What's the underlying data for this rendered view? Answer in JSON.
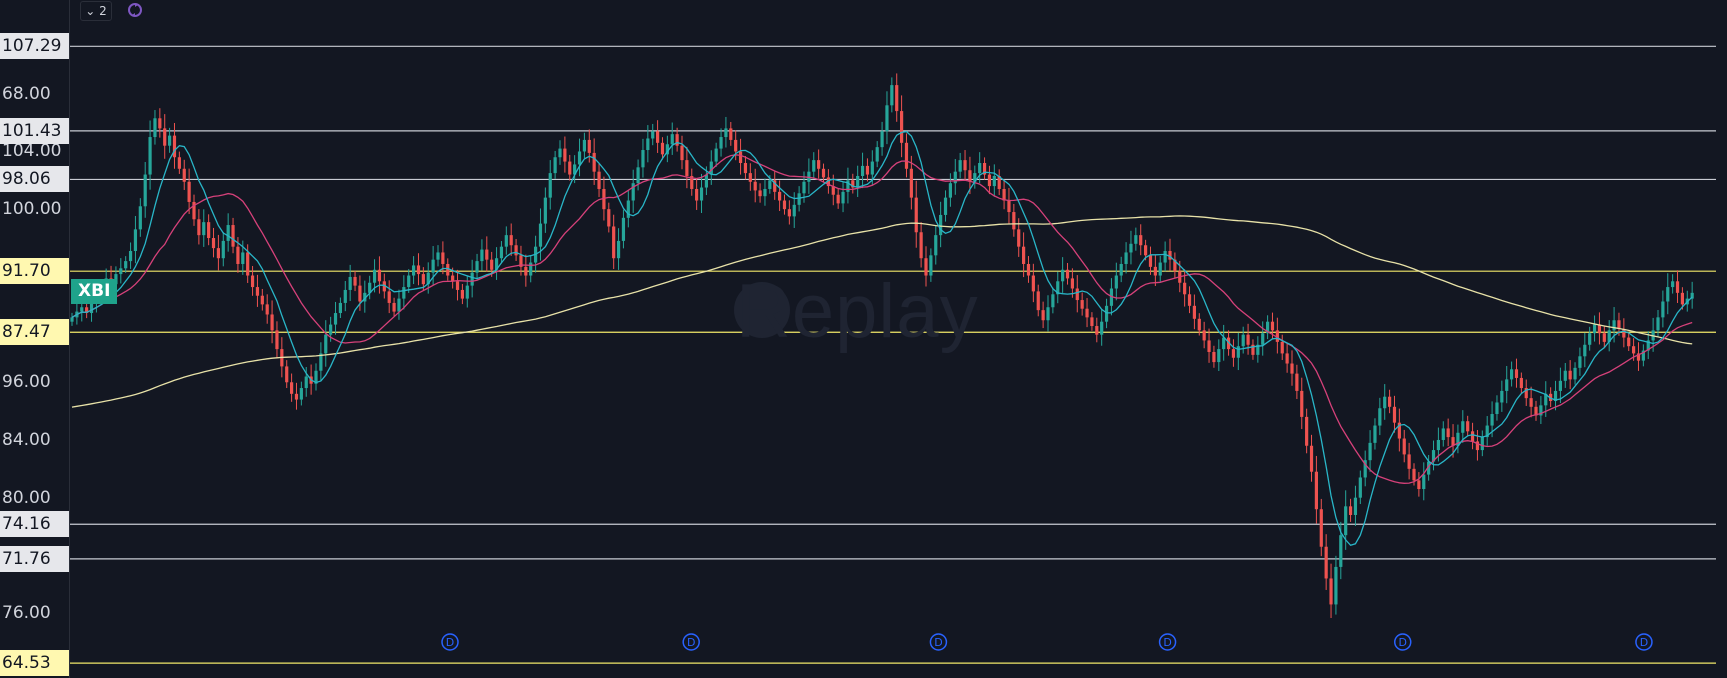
{
  "toolbar": {
    "collapse_label": "⌄ 2",
    "sync_icon": "sync-icon"
  },
  "symbol": "XBI",
  "watermark": "Replay",
  "colors": {
    "background": "#131722",
    "up": "#26a69a",
    "down": "#ef5350",
    "ma_fast": "#29b6c8",
    "ma_mid": "#d6417a",
    "ma_slow": "#e8e2a8",
    "hline_white": "#c8cbd3",
    "hline_yellow": "#f2e86a",
    "dividend_marker": "#2962ff"
  },
  "dividend_marker_label": "D",
  "chart_data": {
    "type": "candlestick",
    "symbol": "XBI",
    "ylim": [
      63.5,
      110.5
    ],
    "y_tick_labels": [
      "76.00",
      "80.00",
      "84.00",
      "96.00",
      "100.00",
      "104.00",
      "68.00"
    ],
    "y_ticks": [
      68,
      76,
      80,
      84,
      96,
      100,
      104
    ],
    "horizontal_levels": [
      {
        "label": "107.29",
        "value": 107.29,
        "color": "white"
      },
      {
        "label": "101.43",
        "value": 101.43,
        "color": "white"
      },
      {
        "label": "98.06",
        "value": 98.06,
        "color": "white"
      },
      {
        "label": "91.70",
        "value": 91.7,
        "color": "yellow"
      },
      {
        "label": "87.47",
        "value": 87.47,
        "color": "yellow"
      },
      {
        "label": "74.16",
        "value": 74.16,
        "color": "white"
      },
      {
        "label": "71.76",
        "value": 71.76,
        "color": "white"
      },
      {
        "label": "64.53",
        "value": 64.53,
        "color": "yellow"
      }
    ],
    "dividend_markers_bar_index": [
      64,
      104,
      145,
      183,
      222,
      262
    ],
    "closes": [
      88.5,
      88.9,
      89.2,
      88.8,
      89.6,
      90.1,
      90.6,
      91.2,
      90.8,
      91.5,
      91.9,
      92.4,
      93.1,
      94.6,
      96.2,
      98.4,
      101.0,
      102.3,
      101.6,
      100.4,
      101.1,
      99.6,
      98.8,
      97.9,
      96.5,
      95.3,
      94.2,
      95.1,
      94.0,
      93.3,
      92.6,
      93.8,
      94.9,
      93.4,
      92.2,
      93.0,
      91.4,
      90.6,
      90.0,
      89.4,
      88.7,
      87.6,
      86.3,
      85.1,
      84.0,
      83.2,
      82.8,
      83.6,
      84.4,
      83.9,
      84.8,
      86.0,
      87.3,
      88.0,
      88.8,
      89.5,
      90.4,
      91.3,
      90.7,
      89.6,
      90.2,
      90.9,
      91.8,
      91.0,
      90.3,
      89.5,
      88.9,
      89.8,
      90.6,
      91.4,
      92.1,
      91.5,
      90.8,
      91.6,
      92.5,
      93.0,
      92.2,
      91.4,
      91.0,
      90.4,
      89.8,
      90.7,
      91.6,
      92.4,
      93.2,
      92.5,
      91.8,
      92.6,
      93.4,
      94.2,
      93.5,
      92.8,
      92.0,
      91.4,
      92.3,
      93.4,
      95.0,
      96.8,
      98.5,
      99.6,
      100.2,
      99.3,
      98.4,
      99.1,
      100.0,
      100.8,
      99.9,
      98.6,
      97.4,
      96.0,
      94.8,
      92.6,
      93.8,
      95.4,
      96.6,
      97.8,
      98.9,
      100.1,
      100.9,
      101.4,
      100.6,
      99.8,
      100.5,
      101.2,
      100.4,
      99.4,
      98.3,
      97.4,
      96.6,
      97.5,
      98.4,
      99.3,
      100.2,
      101.0,
      101.6,
      100.8,
      100.0,
      99.2,
      98.5,
      97.9,
      97.3,
      96.9,
      97.4,
      98.0,
      97.2,
      96.6,
      96.0,
      95.5,
      96.3,
      97.1,
      97.9,
      98.6,
      99.4,
      98.8,
      98.2,
      97.6,
      97.0,
      96.4,
      97.2,
      98.0,
      97.5,
      98.3,
      99.0,
      98.4,
      99.3,
      100.3,
      101.4,
      103.2,
      104.6,
      102.8,
      100.6,
      98.8,
      96.8,
      94.4,
      92.6,
      91.4,
      92.8,
      94.2,
      95.6,
      96.8,
      97.8,
      98.6,
      99.4,
      98.7,
      97.9,
      98.5,
      99.2,
      98.4,
      97.6,
      98.3,
      97.4,
      96.6,
      95.8,
      94.6,
      93.4,
      92.2,
      91.4,
      90.3,
      89.0,
      88.3,
      89.2,
      90.1,
      91.0,
      91.8,
      91.2,
      90.5,
      89.7,
      89.1,
      88.5,
      87.9,
      87.3,
      88.2,
      89.3,
      90.5,
      91.4,
      92.2,
      93.0,
      93.6,
      94.2,
      93.5,
      92.8,
      92.0,
      91.4,
      92.3,
      93.1,
      92.5,
      91.7,
      90.9,
      90.1,
      89.3,
      88.4,
      87.6,
      86.9,
      86.1,
      85.4,
      86.3,
      87.1,
      86.3,
      85.7,
      86.5,
      87.3,
      86.6,
      85.9,
      86.6,
      87.4,
      88.2,
      87.6,
      86.8,
      86.0,
      85.3,
      84.6,
      83.4,
      81.6,
      79.6,
      77.8,
      75.2,
      72.6,
      70.4,
      68.6,
      71.2,
      73.4,
      75.4,
      74.8,
      76.0,
      77.4,
      78.6,
      79.8,
      81.0,
      82.2,
      83.0,
      82.3,
      81.2,
      80.1,
      79.0,
      78.0,
      77.2,
      76.6,
      77.6,
      78.5,
      79.3,
      80.0,
      80.8,
      80.2,
      79.6,
      80.5,
      81.3,
      80.6,
      79.9,
      79.3,
      80.2,
      81.0,
      81.8,
      82.6,
      83.4,
      84.2,
      84.9,
      84.3,
      83.6,
      82.9,
      82.3,
      81.7,
      82.4,
      83.2,
      82.7,
      83.4,
      84.1,
      84.8,
      84.2,
      85.0,
      85.8,
      86.6,
      87.4,
      88.0,
      87.4,
      86.8,
      87.6,
      88.3,
      87.7,
      87.1,
      86.5,
      86.0,
      85.5,
      86.2,
      86.9,
      87.6,
      88.5,
      89.6,
      90.6,
      91.0,
      90.2,
      89.4,
      89.8,
      90.2
    ]
  }
}
